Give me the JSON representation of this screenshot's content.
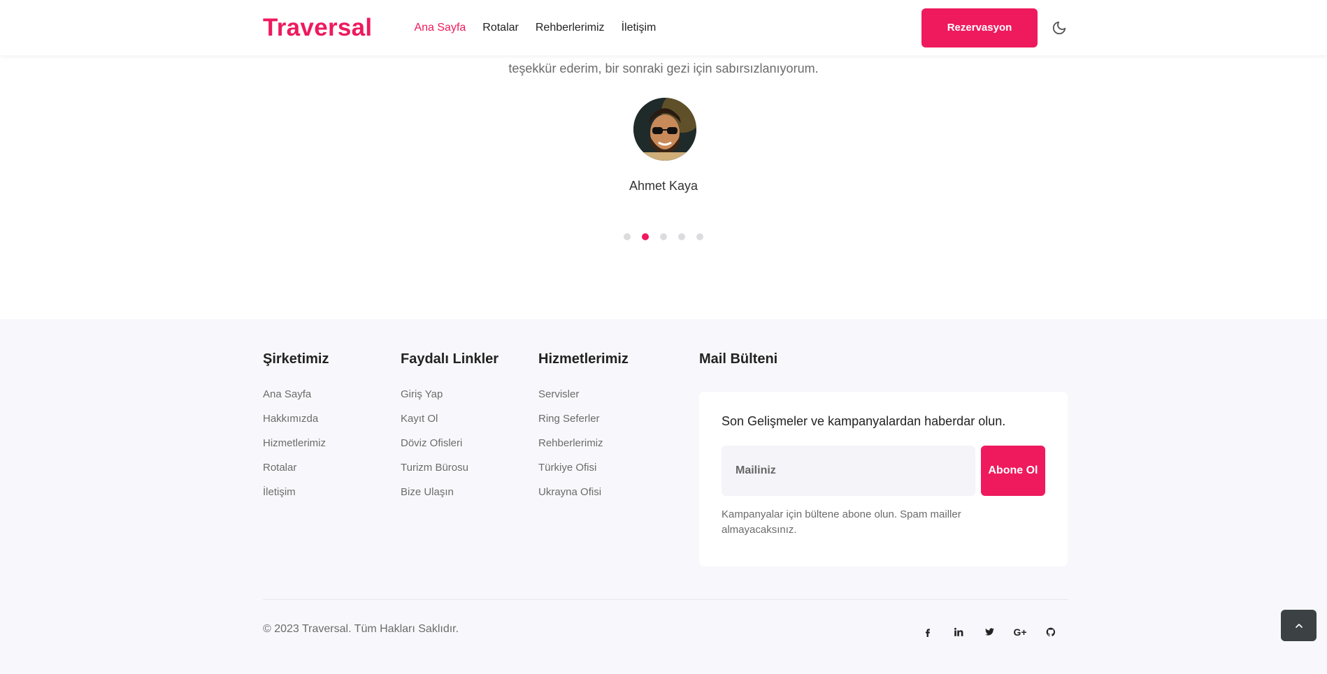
{
  "header": {
    "logo": "Traversal",
    "nav": [
      "Ana Sayfa",
      "Rotalar",
      "Rehberlerimiz",
      "İletişim"
    ],
    "reservation_label": "Rezervasyon"
  },
  "testimonial": {
    "quote_tail": "teşekkür ederim, bir sonraki gezi için sabırsızlanıyorum.",
    "name": "Ahmet Kaya",
    "active_slide": 2,
    "slide_count": 5
  },
  "footer": {
    "company": {
      "title": "Şirketimiz",
      "links": [
        "Ana Sayfa",
        "Hakkımızda",
        "Hizmetlerimiz",
        "Rotalar",
        "İletişim"
      ]
    },
    "useful": {
      "title": "Faydalı Linkler",
      "links": [
        "Giriş Yap",
        "Kayıt Ol",
        "Döviz Ofisleri",
        "Turizm Bürosu",
        "Bize Ulaşın"
      ]
    },
    "services": {
      "title": "Hizmetlerimiz",
      "links": [
        "Servisler",
        "Ring Seferler",
        "Rehberlerimiz",
        "Türkiye Ofisi",
        "Ukrayna Ofisi"
      ]
    },
    "newsletter": {
      "title": "Mail Bülteni",
      "subtitle": "Son Gelişmeler ve kampanyalardan haberdar olun.",
      "placeholder": "Mailiniz",
      "button": "Abone Ol",
      "note": "Kampanyalar için bültene abone olun. Spam mailler almayacaksınız."
    },
    "copyright": "© 2023 Traversal. Tüm Hakları Saklıdır.",
    "socials": [
      "facebook-icon",
      "linkedin-icon",
      "twitter-icon",
      "google-plus-icon",
      "github-icon"
    ]
  },
  "colors": {
    "accent": "#ee1a5d",
    "footer_bg": "#f8f8fc"
  }
}
